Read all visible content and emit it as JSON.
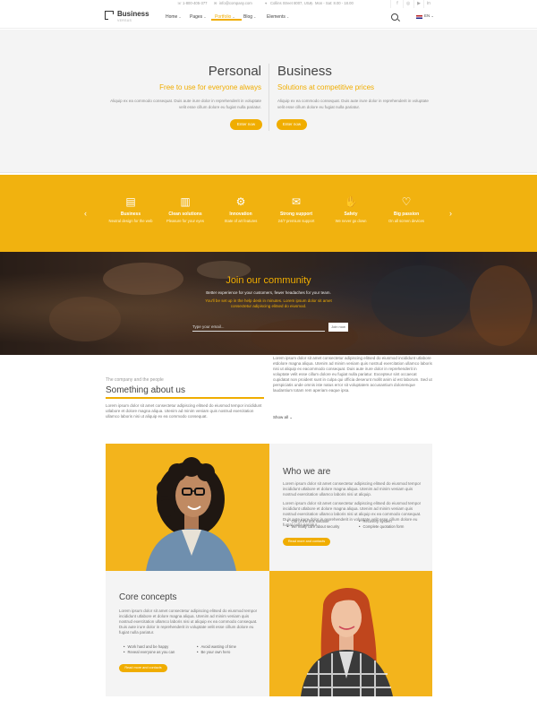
{
  "topbar": {
    "phone": "1-800-405-377",
    "email": "info@company.com",
    "address": "Collins Street 8007, USA",
    "hours": "Mon - Sat: 8.00 - 18.00",
    "social_icons": [
      "facebook-icon",
      "instagram-icon",
      "youtube-icon",
      "linkedin-icon"
    ]
  },
  "nav": {
    "logo_text": "Business",
    "logo_sub": "VERSUS",
    "items": [
      {
        "label": "Home"
      },
      {
        "label": "Pages"
      },
      {
        "label": "Portfolio"
      },
      {
        "label": "Blog"
      },
      {
        "label": "Elements"
      }
    ],
    "lang": "EN"
  },
  "hero": {
    "left_title": "Personal",
    "left_sub": "Free to use for everyone always",
    "left_text": "Aliquip ex ea commodo consequat. Duis aute irure dolor in reprehenderit in voluptate velit esse cillum dolore eu fugiat nulla pariatur.",
    "left_button": "Enter now",
    "right_title": "Business",
    "right_sub": "Solutions at competitive prices",
    "right_text": "Aliquip ex ea commodo consequat. Duis aute irure dolor in reprehenderit in voluptate velit esse cillum dolore eu fugiat nulla pariatur.",
    "right_button": "Enter now"
  },
  "features": [
    {
      "title": "Business",
      "desc": "Neutral design for the web",
      "icon": "id-card-icon"
    },
    {
      "title": "Clean solutions",
      "desc": "Pleasure for your eyes",
      "icon": "bar-chart-icon"
    },
    {
      "title": "Innovation",
      "desc": "State of art features",
      "icon": "gear-icon"
    },
    {
      "title": "Strong support",
      "desc": "24/7 premium support",
      "icon": "envelope-icon"
    },
    {
      "title": "Safety",
      "desc": "We never go down",
      "icon": "hand-icon"
    },
    {
      "title": "Big passion",
      "desc": "On all screen devices",
      "icon": "heart-icon"
    }
  ],
  "community": {
    "title": "Join our community",
    "line1": "Better experience for your customers, fewer headaches for your team.",
    "line2a": "You'll be set up in the help desk in minutes. Lorem ipsum dolor sit amet",
    "line2b": "consectetur adipiscing elitsed do eiusmod.",
    "email_placeholder": "Type your email...",
    "join_button": "Join now"
  },
  "about": {
    "small": "The company and the people",
    "title": "Something about us",
    "text": "Lorem ipsum dolor sit amet consectetur adipiscing elitsed do eiusmod tempor incididunt utlabore et dolore magna aliqua. Utenim ad minim veniam quis nostrud exercitation ullamco laboris nisi ut aliquip ex ea commodo consequat.",
    "right_text": "Lorem ipsum dolor sit amet consectetur adipiscing elitsed do eiusmod incididunt utlabore etdolore magna aliqua. Utenim ad minim veniam quis nostrud exercitation ullamco laboris nisi ut aliquip ex eacommodo consequat. Duis aute irure dolor in reprehenderit in voluptate velit esse cillum dolore eu fugiat nulla pariatur. Excepteur sint occaecat cupidatat non proident sunt in culpa qui officia deserunt mollit anim id est laborum. Sed ut perspiciatis unde omnis iste natus error sit voluptatem accusantium doloremque laudantium totam rem aperiam eaque ipsa.",
    "show_all": "Show all"
  },
  "who": {
    "title": "Who we are",
    "text1": "Lorem ipsum dolor sit amet consectetur adipiscing elitsed do eiusmod tempor incididunt utlabore et dolore magna aliqua. Utenim ad minim veniam quis nostrud exercitation ullamco laboris nisi ut aliquip.",
    "text2": "Lorem ipsum dolor sit amet consectetur adipiscing elitsed do eiusmod tempor incididunt utlabore et dolore magna aliqua. Utenim ad minim veniam quis nostrud exercitation ullamco laboris nisi ut aliquip ex ea commodo consequat. Duis aute irure dolor in reprehenderit in voluptate velit esse cillum dolore eu fugiat nulla pariatur.",
    "bullets": [
      "Out of the box solution",
      "We really care about security",
      "Recovery system",
      "Complete quotation form"
    ],
    "button": "Read more and contacts"
  },
  "core": {
    "title": "Core concepts",
    "text": "Lorem ipsum dolor sit amet consectetur adipiscing elitsed do eiusmod tempor incididunt utlabore et dolore magna aliqua. Utenim ad minim veniam quis nostrud exercitation ullamco laboris nisi ut aliquip ex ea commodo consequat. Duis aute irure dolor in reprehenderit in voluptate velit esse cillum dolore eu fugiat nulla pariatur.",
    "bullets": [
      "Work hard and be happy",
      "Reveal everyone as you can",
      "Avoid wasting of time",
      "Be your own hero"
    ],
    "button": "Read more and contacts"
  },
  "colors": {
    "accent": "#f0ad00",
    "band": "#f1b20f"
  }
}
